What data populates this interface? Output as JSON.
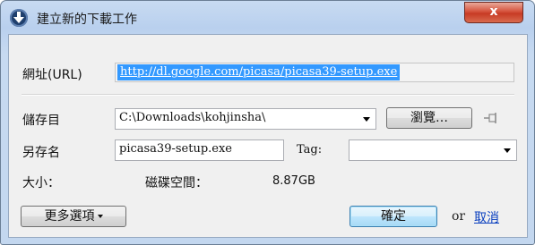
{
  "window": {
    "title": "建立新的下載工作",
    "close_symbol": "x"
  },
  "url_row": {
    "label": "網址(URL)",
    "value": "http://dl.google.com/picasa/picasa39-setup.exe"
  },
  "folder_row": {
    "label": "儲存目",
    "value": "C:\\Downloads\\kohjinsha\\",
    "browse_label": "瀏覽…"
  },
  "name_row": {
    "label": "另存名",
    "value": "picasa39-setup.exe",
    "tag_label": "Tag:",
    "tag_value": ""
  },
  "size_row": {
    "size_label": "大小：",
    "disk_label": "磁碟空間：",
    "disk_value": "8.87GB"
  },
  "actions": {
    "more_label": "更多選項",
    "ok_label": "確定",
    "or_text": "or",
    "cancel_label": "取消"
  },
  "colors": {
    "selection": "#3399ff",
    "link": "#0a3fbf",
    "title_bg": "#c8dbf2"
  }
}
